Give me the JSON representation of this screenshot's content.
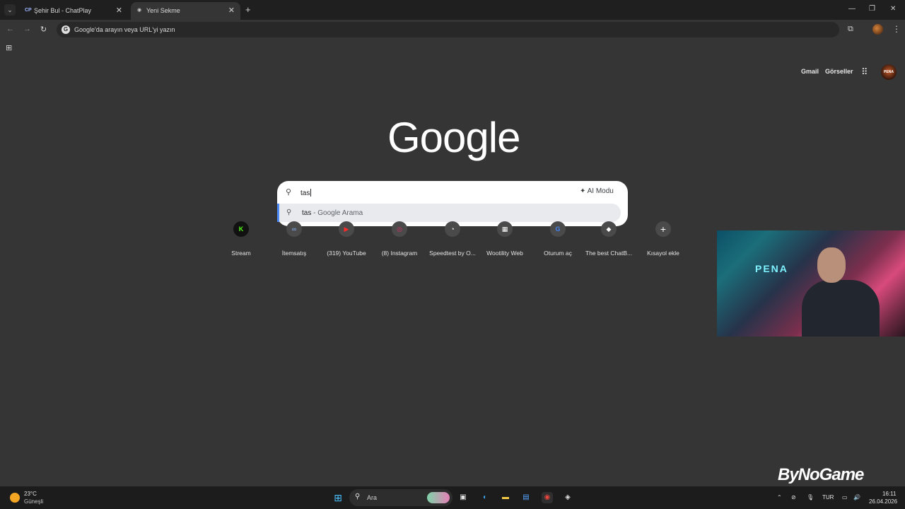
{
  "tabs": [
    {
      "favicon": "CP",
      "title": "Şehir Bul - ChatPlay",
      "active": false
    },
    {
      "favicon": "chrome-icon",
      "title": "Yeni Sekme",
      "active": true
    }
  ],
  "omnibox": {
    "placeholder": "Google'da arayın veya URL'yi yazın"
  },
  "header_links": {
    "gmail": "Gmail",
    "images": "Görseller"
  },
  "logo": {
    "text": "Google"
  },
  "search": {
    "value": "tas",
    "ai_mode": "AI Modu",
    "suggestion_query": "tas",
    "suggestion_suffix": " - Google Arama"
  },
  "shortcuts": [
    {
      "label": "Stream",
      "icon": "K",
      "color": "#53fc18"
    },
    {
      "label": "İtemsatış",
      "icon": "🔗",
      "color": "#3b7ddd"
    },
    {
      "label": "(319) YouTube",
      "icon": "▶",
      "color": "#ff0000"
    },
    {
      "label": "(8) Instagram",
      "icon": "◎",
      "color": "#d62976"
    },
    {
      "label": "Speedtest by O...",
      "icon": "◔",
      "color": "#141526"
    },
    {
      "label": "Wootility Web",
      "icon": "▦",
      "color": "#2a2a2a"
    },
    {
      "label": "Oturum aç",
      "icon": "G",
      "color": "#ffffff"
    },
    {
      "label": "The best ChatB...",
      "icon": "◆",
      "color": "#ffffff"
    },
    {
      "label": "Kısayol ekle",
      "icon": "+",
      "color": "#4a4a4a"
    }
  ],
  "webcam": {
    "logo": "PENA"
  },
  "watermark": "ByNoGame",
  "taskbar": {
    "weather_temp": "23°C",
    "weather_desc": "Güneşli",
    "search_label": "Ara",
    "language": "TUR",
    "time": "16:11",
    "date": "26.04.2026"
  }
}
